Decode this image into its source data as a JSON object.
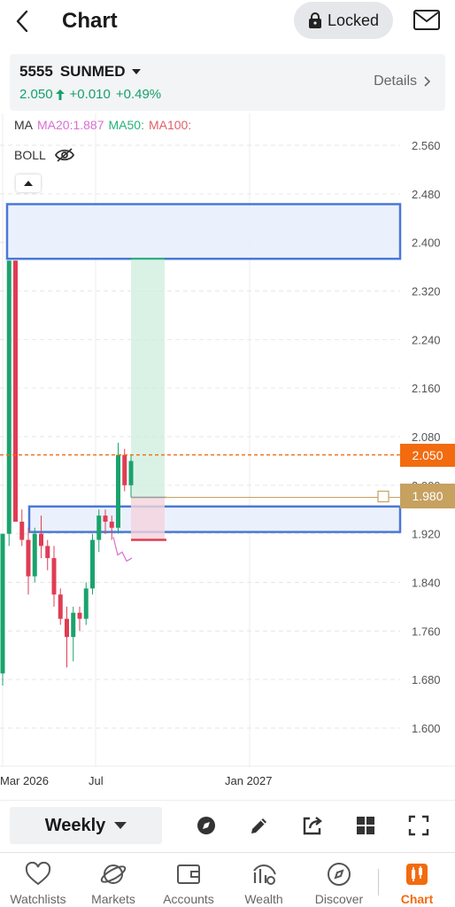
{
  "header": {
    "title": "Chart",
    "locked_label": "Locked"
  },
  "quote": {
    "code": "5555",
    "name": "SUNMED",
    "price": "2.050",
    "change": "+0.010",
    "change_pct": "+0.49%",
    "details_label": "Details",
    "up_color": "#16a06a"
  },
  "indicators": {
    "ma_label": "MA",
    "ma20": "MA20:1.887",
    "ma50": "MA50:",
    "ma100": "MA100:",
    "ma20_color": "#d86fd0",
    "ma50_color": "#25b27a",
    "ma100_color": "#e25f6a",
    "boll_label": "BOLL"
  },
  "chart_data": {
    "type": "candlestick",
    "y_ticks": [
      "2.560",
      "2.480",
      "2.400",
      "2.320",
      "2.240",
      "2.160",
      "2.080",
      "2.000",
      "1.920",
      "1.840",
      "1.760",
      "1.680",
      "1.600"
    ],
    "x_ticks": [
      "Mar 2026",
      "Jul",
      "Jan 2027"
    ],
    "ylim": [
      1.56,
      2.59
    ],
    "current_price": "2.050",
    "level_price": "1.980",
    "zones": [
      {
        "from": 2.373,
        "to": 2.463
      },
      {
        "from": 1.923,
        "to": 1.965
      }
    ],
    "candles": [
      {
        "o": 1.69,
        "h": 1.72,
        "l": 1.67,
        "c": 1.92
      },
      {
        "o": 1.92,
        "h": 2.37,
        "l": 1.9,
        "c": 2.37
      },
      {
        "o": 2.37,
        "h": 2.37,
        "l": 1.94,
        "c": 1.94
      },
      {
        "o": 1.94,
        "h": 1.96,
        "l": 1.9,
        "c": 1.91
      },
      {
        "o": 1.91,
        "h": 1.93,
        "l": 1.82,
        "c": 1.85
      },
      {
        "o": 1.85,
        "h": 1.93,
        "l": 1.84,
        "c": 1.92
      },
      {
        "o": 1.92,
        "h": 1.95,
        "l": 1.88,
        "c": 1.9
      },
      {
        "o": 1.9,
        "h": 1.91,
        "l": 1.86,
        "c": 1.88
      },
      {
        "o": 1.88,
        "h": 1.9,
        "l": 1.8,
        "c": 1.82
      },
      {
        "o": 1.82,
        "h": 1.83,
        "l": 1.77,
        "c": 1.78
      },
      {
        "o": 1.78,
        "h": 1.8,
        "l": 1.7,
        "c": 1.75
      },
      {
        "o": 1.75,
        "h": 1.8,
        "l": 1.71,
        "c": 1.79
      },
      {
        "o": 1.79,
        "h": 1.8,
        "l": 1.76,
        "c": 1.78
      },
      {
        "o": 1.78,
        "h": 1.84,
        "l": 1.77,
        "c": 1.83
      },
      {
        "o": 1.83,
        "h": 1.92,
        "l": 1.82,
        "c": 1.91
      },
      {
        "o": 1.91,
        "h": 1.96,
        "l": 1.89,
        "c": 1.95
      },
      {
        "o": 1.95,
        "h": 1.96,
        "l": 1.92,
        "c": 1.94
      },
      {
        "o": 1.94,
        "h": 1.95,
        "l": 1.91,
        "c": 1.93
      },
      {
        "o": 1.93,
        "h": 2.07,
        "l": 1.92,
        "c": 2.05
      },
      {
        "o": 2.05,
        "h": 2.06,
        "l": 1.99,
        "c": 2.0
      },
      {
        "o": 2.0,
        "h": 2.05,
        "l": 1.98,
        "c": 2.04
      }
    ],
    "up_color": "#1aa36d",
    "down_color": "#df3d54"
  },
  "toolbar": {
    "period": "Weekly"
  },
  "tabs": [
    {
      "label": "Watchlists"
    },
    {
      "label": "Markets"
    },
    {
      "label": "Accounts"
    },
    {
      "label": "Wealth"
    },
    {
      "label": "Discover"
    },
    {
      "label": "Chart"
    }
  ],
  "colors": {
    "accent": "#f26b0f",
    "zone_fill": "#e8eefc",
    "zone_border": "#4a78d6"
  }
}
